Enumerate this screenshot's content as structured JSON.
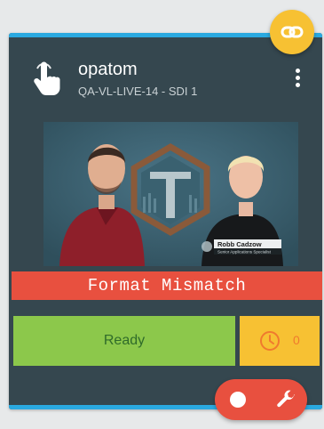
{
  "source": {
    "name": "opatom",
    "subtitle": "QA-VL-LIVE-14 - SDI 1"
  },
  "preview": {
    "lower_third_name": "Robb Cadzow",
    "lower_third_title": "Senior Applications Specialist"
  },
  "status": {
    "banner": "Format Mismatch",
    "ready_label": "Ready",
    "timer_count": "0"
  },
  "icons": {
    "source": "hand-pointer-icon",
    "menu": "kebab-menu-icon",
    "link": "link-icon",
    "clock": "clock-icon",
    "record": "record-icon",
    "settings": "wrench-icon"
  },
  "colors": {
    "card_bg": "#35474f",
    "accent_strip": "#2aa9e0",
    "error": "#e8503f",
    "ready": "#8cc84b",
    "ready_text": "#2f6b2a",
    "timer": "#f7c133",
    "timer_text": "#f07a2e"
  }
}
